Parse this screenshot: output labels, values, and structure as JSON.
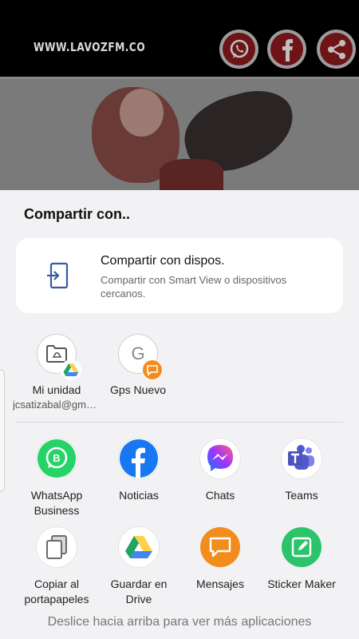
{
  "app": {
    "site_label": "WWW.LAVOZFM.CO",
    "social_buttons": [
      {
        "icon": "whatsapp-icon"
      },
      {
        "icon": "facebook-icon"
      },
      {
        "icon": "share-icon"
      }
    ]
  },
  "share_sheet": {
    "title": "Compartir con..",
    "nearby": {
      "title": "Compartir con dispos.",
      "subtitle": "Compartir con Smart View o dispositivos cercanos."
    },
    "contacts": [
      {
        "name": "Mi unidad",
        "sub": "jcsatizabal@gmail.com",
        "badge": "google-drive-icon"
      },
      {
        "name": "Gps Nuevo",
        "sub": "",
        "initial": "G",
        "badge": "message-icon"
      }
    ],
    "apps": [
      {
        "label": "WhatsApp Business",
        "icon": "whatsapp-business-icon"
      },
      {
        "label": "Noticias",
        "icon": "facebook-icon"
      },
      {
        "label": "Chats",
        "icon": "messenger-icon"
      },
      {
        "label": "Teams",
        "icon": "teams-icon"
      },
      {
        "label": "Copiar al portapapeles",
        "icon": "copy-icon"
      },
      {
        "label": "Guardar en Drive",
        "icon": "google-drive-icon"
      },
      {
        "label": "Mensajes",
        "icon": "messages-icon"
      },
      {
        "label": "Sticker Maker",
        "icon": "sticker-maker-icon"
      }
    ],
    "footer_hint": "Deslice hacia arriba para ver más aplicaciones"
  },
  "colors": {
    "whatsapp": "#25D366",
    "facebook": "#1877F2",
    "teams": "#5059C9",
    "drive_green": "#1FA463",
    "drive_yellow": "#FFD04B",
    "drive_blue": "#4285F4",
    "messages_orange": "#F28C1B",
    "sticker_green": "#2CC46B"
  }
}
